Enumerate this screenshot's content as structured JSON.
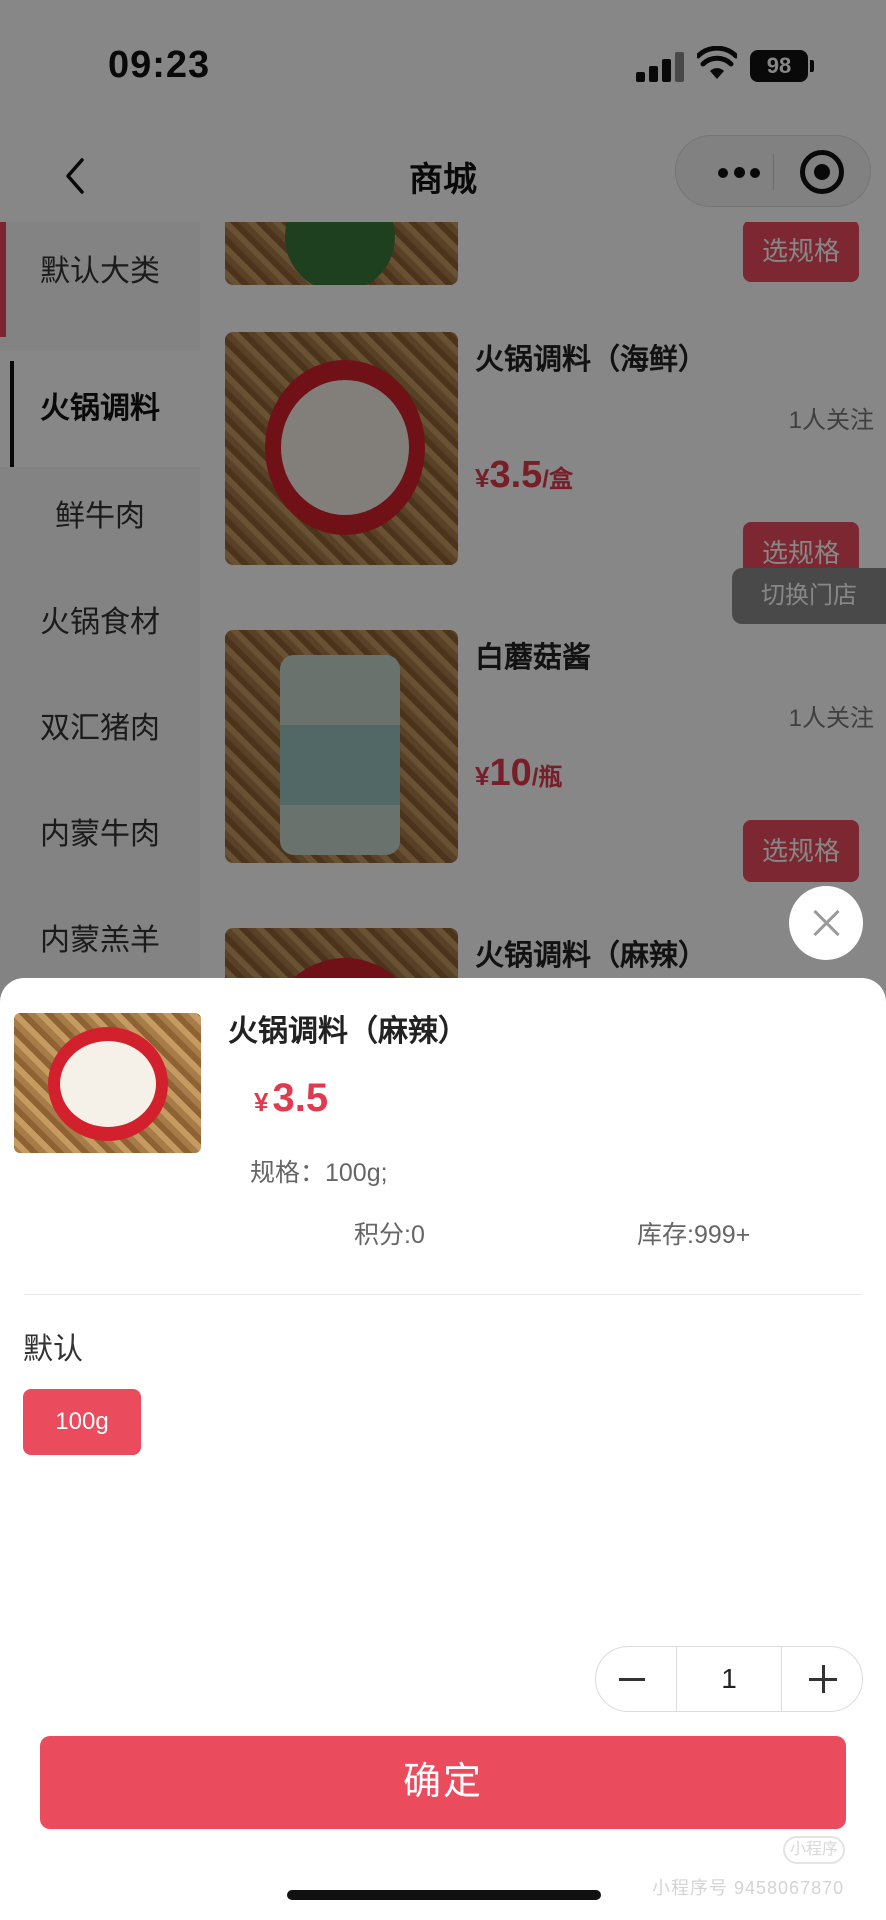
{
  "status_bar": {
    "time": "09:23",
    "battery": "98"
  },
  "nav": {
    "title": "商城"
  },
  "sidebar": {
    "items": [
      {
        "label": "默认大类"
      },
      {
        "label": "火锅调料"
      },
      {
        "label": "鲜牛肉"
      },
      {
        "label": "火锅食材"
      },
      {
        "label": "双汇猪肉"
      },
      {
        "label": "内蒙牛肉"
      },
      {
        "label": "内蒙羔羊"
      }
    ],
    "active": "火锅调料"
  },
  "products": [
    {
      "name": "",
      "fans": "",
      "currency": "",
      "price": "",
      "unit": "",
      "button": "选规格"
    },
    {
      "name": "火锅调料（海鲜）",
      "fans": "1人关注",
      "currency": "¥",
      "price": "3.5",
      "unit": "/盒",
      "button": "选规格"
    },
    {
      "name": "白蘑菇酱",
      "fans": "1人关注",
      "currency": "¥",
      "price": "10",
      "unit": "/瓶",
      "button": "选规格"
    },
    {
      "name": "火锅调料（麻辣）"
    }
  ],
  "floating": {
    "switch_store": "切换门店"
  },
  "sheet": {
    "product_name": "火锅调料（麻辣）",
    "currency": "¥",
    "price": "3.5",
    "spec": "规格：100g;",
    "points": "积分:0",
    "stock": "库存:999+",
    "group_label": "默认",
    "options": [
      "100g"
    ],
    "selected_option": "100g",
    "quantity": "1",
    "confirm": "确定"
  },
  "watermark": {
    "badge": "小程序",
    "text": "小程序号 9458067870"
  },
  "colors": {
    "accent": "#ea4b5d",
    "price": "#e03a4f",
    "overlay": "rgba(0,0,0,0.47)"
  }
}
